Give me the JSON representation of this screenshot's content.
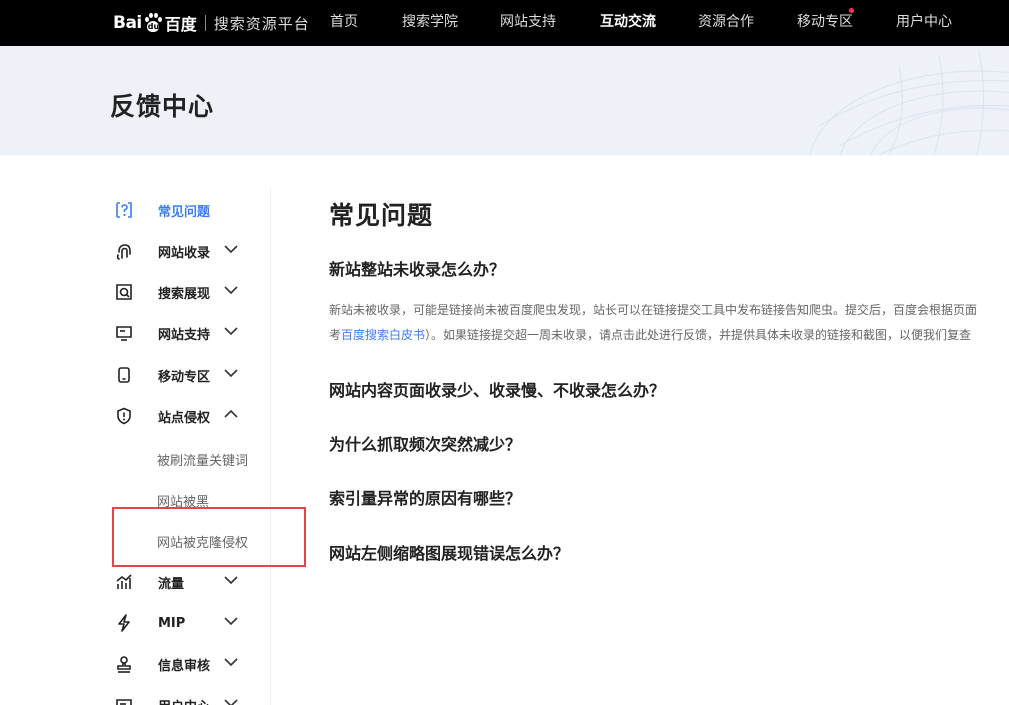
{
  "header": {
    "logo_bai": "Bai",
    "logo_du": "du",
    "logo_baidu": "百度",
    "logo_sub": "搜索资源平台",
    "nav": [
      {
        "label": "首页"
      },
      {
        "label": "搜索学院"
      },
      {
        "label": "网站支持"
      },
      {
        "label": "互动交流"
      },
      {
        "label": "资源合作"
      },
      {
        "label": "移动专区"
      },
      {
        "label": "用户中心"
      }
    ],
    "active_nav": "互动交流",
    "accent_dot_color": "#f5354f"
  },
  "banner": {
    "title": "反馈中心"
  },
  "sidebar": {
    "items": [
      {
        "label": "常见问题",
        "icon": "question-icon",
        "active": true
      },
      {
        "label": "网站收录",
        "icon": "fingerprint-icon",
        "expanded": false
      },
      {
        "label": "搜索展现",
        "icon": "search-frame-icon",
        "expanded": false
      },
      {
        "label": "网站支持",
        "icon": "monitor-icon",
        "expanded": false
      },
      {
        "label": "移动专区",
        "icon": "mobile-icon",
        "expanded": false
      },
      {
        "label": "站点侵权",
        "icon": "shield-alert-icon",
        "expanded": true
      },
      {
        "label": "流量",
        "icon": "chart-bars-icon",
        "expanded": false
      },
      {
        "label": "MIP",
        "icon": "lightning-icon",
        "expanded": false
      },
      {
        "label": "信息审核",
        "icon": "stamp-icon",
        "expanded": false
      },
      {
        "label": "用户中心",
        "icon": "user-center-icon",
        "expanded": false
      }
    ],
    "subitems": [
      "被刷流量关键词",
      "网站被黑",
      "网站被克隆侵权"
    ],
    "active_color": "#3b7cff",
    "highlight_color": "#e8434b"
  },
  "main": {
    "title": "常见问题",
    "questions": [
      "新站整站未收录怎么办？",
      "网站内容页面收录少、收录慢、不收录怎么办？",
      "为什么抓取频次突然减少？",
      "索引量异常的原因有哪些？",
      "网站左侧缩略图展现错误怎么办？"
    ],
    "answer": {
      "line1": "新站未被收录，可能是链接尚未被百度爬虫发现，站长可以在链接提交工具中发布链接告知爬虫。提交后，百度会根据页面",
      "line2_prefix": "考",
      "line2_link": "百度搜索白皮书",
      "line2_suffix": "）。如果链接提交超一周未收录，请点击此处进行反馈，并提供具体未收录的链接和截图，以便我们复查"
    }
  }
}
